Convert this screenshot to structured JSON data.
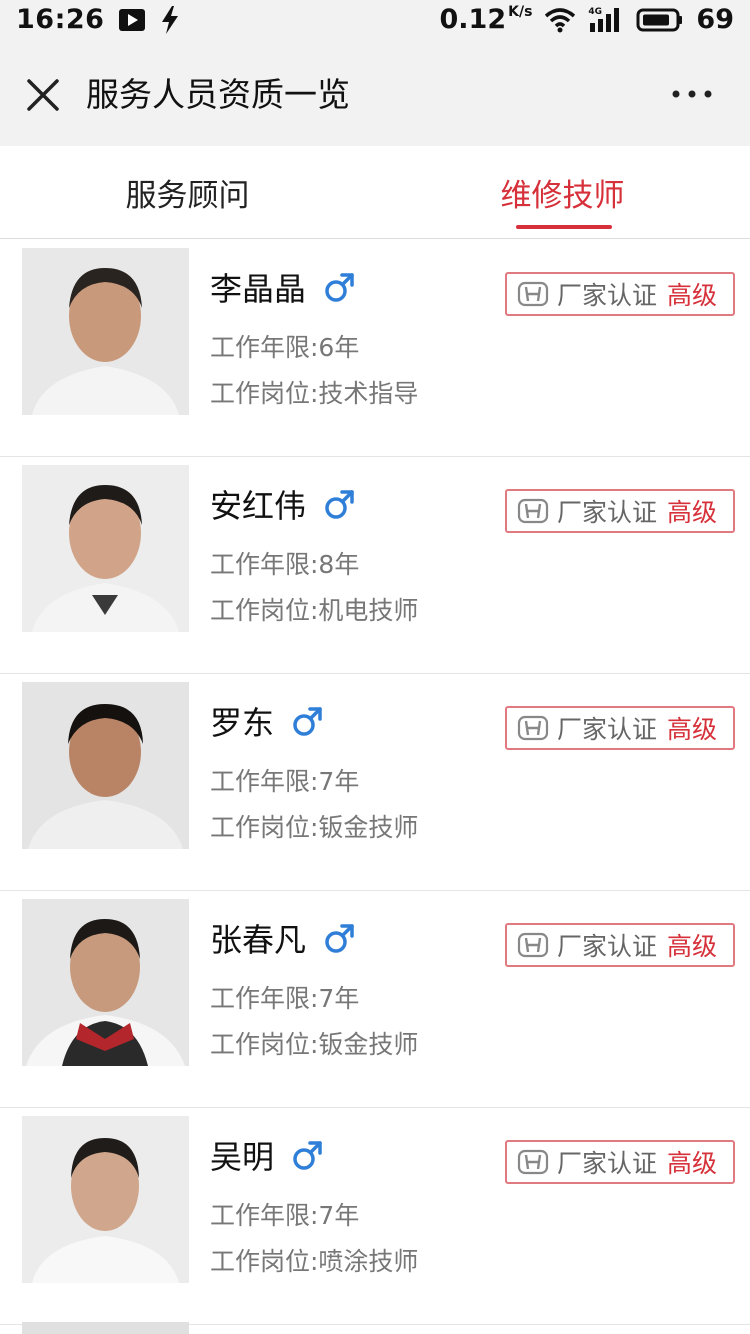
{
  "status_bar": {
    "time": "16:26",
    "speed_value": "0.12",
    "speed_unit": "K/s",
    "network": "4G",
    "battery": "69"
  },
  "nav": {
    "title": "服务人员资质一览"
  },
  "tabs": [
    {
      "label": "服务顾问",
      "active": false
    },
    {
      "label": "维修技师",
      "active": true
    }
  ],
  "colors": {
    "accent": "#d6313a",
    "gender_male": "#2f7fd8"
  },
  "staff": [
    {
      "name": "李晶晶",
      "years": "工作年限:6年",
      "position": "工作岗位:技术指导",
      "cert": "厂家认证",
      "level": "高级"
    },
    {
      "name": "安红伟",
      "years": "工作年限:8年",
      "position": "工作岗位:机电技师",
      "cert": "厂家认证",
      "level": "高级"
    },
    {
      "name": "罗东",
      "years": "工作年限:7年",
      "position": "工作岗位:钣金技师",
      "cert": "厂家认证",
      "level": "高级"
    },
    {
      "name": "张春凡",
      "years": "工作年限:7年",
      "position": "工作岗位:钣金技师",
      "cert": "厂家认证",
      "level": "高级"
    },
    {
      "name": "吴明",
      "years": "工作年限:7年",
      "position": "工作岗位:喷涂技师",
      "cert": "厂家认证",
      "level": "高级"
    }
  ]
}
